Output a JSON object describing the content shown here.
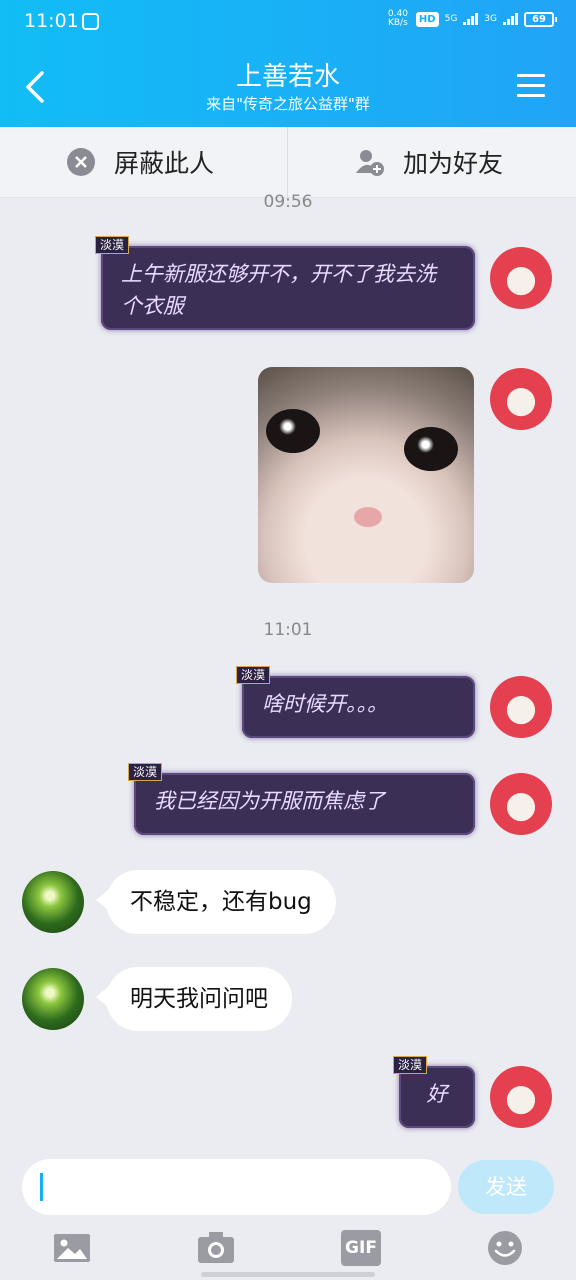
{
  "status": {
    "time": "11:01",
    "speed_value": "0.40",
    "speed_unit": "KB/s",
    "hd": "HD",
    "net1": "5G",
    "net2": "3G",
    "battery": "69"
  },
  "header": {
    "title": "上善若水",
    "subtitle": "来自\"传奇之旅公益群\"群",
    "back_icon": "chevron-left-icon",
    "menu_icon": "hamburger-icon"
  },
  "actions": {
    "block": "屏蔽此人",
    "add_friend": "加为好友"
  },
  "messages": {
    "time1": "09:56",
    "m1": "上午新服还够开不，开不了我去洗个衣服",
    "tag": "淡漠",
    "time2": "11:01",
    "m3": "啥时候开。。。",
    "m4": "我已经因为开服而焦虑了",
    "m5": "不稳定，还有bug",
    "m6": "明天我问问吧",
    "m7": "好"
  },
  "input": {
    "placeholder": "",
    "send_label": "发送"
  },
  "toolbar": {
    "gif_label": "GIF",
    "icons": [
      "image-icon",
      "camera-icon",
      "gif-icon",
      "emoji-icon"
    ]
  },
  "colors": {
    "accent": "#16b1f6",
    "chat_bg": "#ebecf2",
    "bubble_theme": "#3c2f56"
  }
}
